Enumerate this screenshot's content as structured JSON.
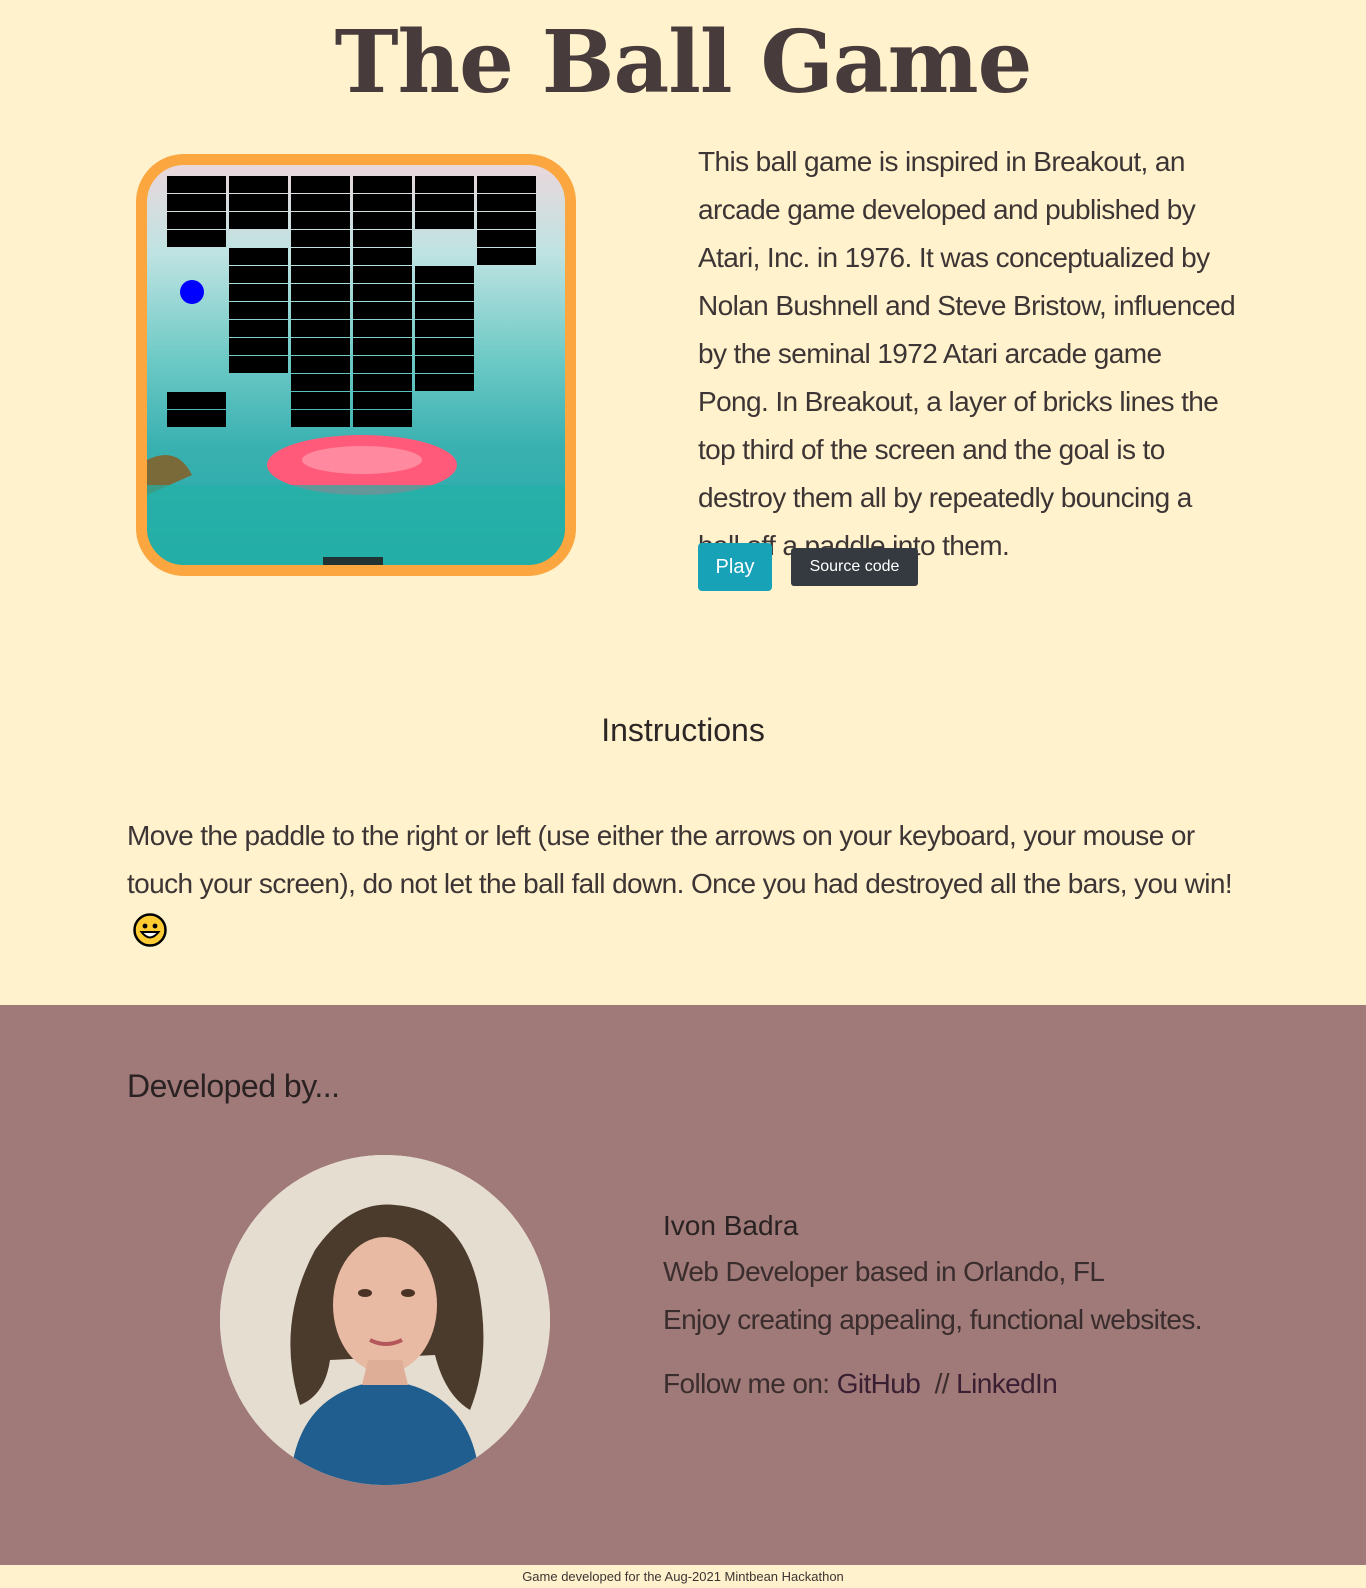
{
  "header": {
    "title": "The Ball Game"
  },
  "about": {
    "text": "This ball game is inspired in Breakout, an arcade game developed and published by Atari, Inc. in 1976. It was conceptualized by Nolan Bushnell and Steve Bristow, influenced by the seminal 1972 Atari arcade game Pong. In Breakout, a layer of bricks lines the top third of the screen and the goal is to destroy them all by repeatedly bouncing a ball off a paddle into them.",
    "play_label": "Play",
    "source_label": "Source code"
  },
  "instructions": {
    "heading": "Instructions",
    "text": "Move the paddle to the right or left (use either the arrows on your keyboard, your mouse or touch your screen), do not let the ball fall down. Once you had destroyed all the bars, you win!"
  },
  "developer": {
    "heading": "Developed by...",
    "name": "Ivon Badra",
    "line1": "Web Developer based in Orlando, FL",
    "line2": "Enjoy creating appealing, functional websites.",
    "follow_prefix": "Follow me on:",
    "github_label": "GitHub",
    "separator": "//",
    "linkedin_label": "LinkedIn"
  },
  "footer": {
    "credit": "Game developed for the Aug-2021 Mintbean Hackathon"
  },
  "game_preview": {
    "ball_color": "#0000ff",
    "brick_color": "#000000",
    "frame_color": "#fba63f"
  },
  "colors": {
    "page_background": "#fff2cc",
    "footer_background": "#a07a78",
    "play_button": "#17a2b8",
    "source_button": "#343a40"
  }
}
